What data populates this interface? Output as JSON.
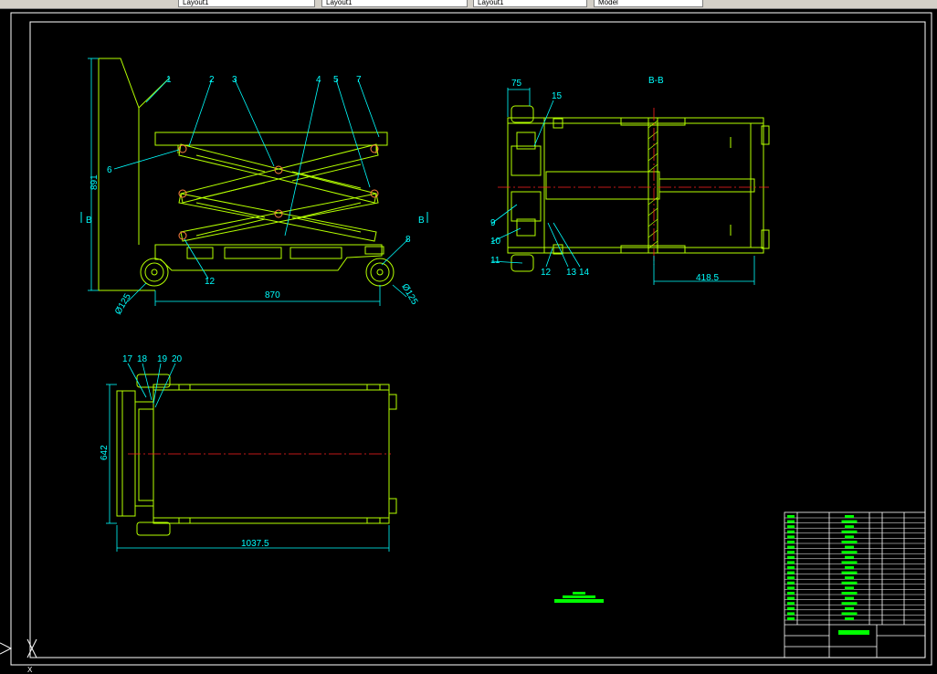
{
  "tabs": [
    {
      "label": "Layout1",
      "active": false
    },
    {
      "label": "Layout1",
      "active": false
    },
    {
      "label": "Layout1",
      "active": false
    },
    {
      "label": "Model",
      "active": false
    }
  ],
  "side_view": {
    "part_numbers": [
      "1",
      "2",
      "3",
      "4",
      "5",
      "7",
      "6",
      "8",
      "12"
    ],
    "dim_length": "870",
    "dim_height": "891",
    "dim_wheel_left": "Ø125",
    "dim_wheel_right": "Ø125",
    "section_mark_left": "B",
    "section_mark_right": "B"
  },
  "section_view": {
    "title": "B-B",
    "dim_top": "75",
    "dim_bottom": "418.5",
    "part_numbers": [
      "15",
      "9",
      "10",
      "11",
      "12",
      "13",
      "14"
    ]
  },
  "top_view": {
    "part_numbers": [
      "17",
      "18",
      "19",
      "20"
    ],
    "dim_width": "642",
    "dim_length": "1037.5"
  },
  "ucs_label": "X",
  "colors": {
    "background": "#000000",
    "geometry": "#b4ff00",
    "dimension": "#00ffff",
    "centerline": "#ff2020",
    "frame": "#ffffff",
    "title_block": "#00ff00"
  }
}
